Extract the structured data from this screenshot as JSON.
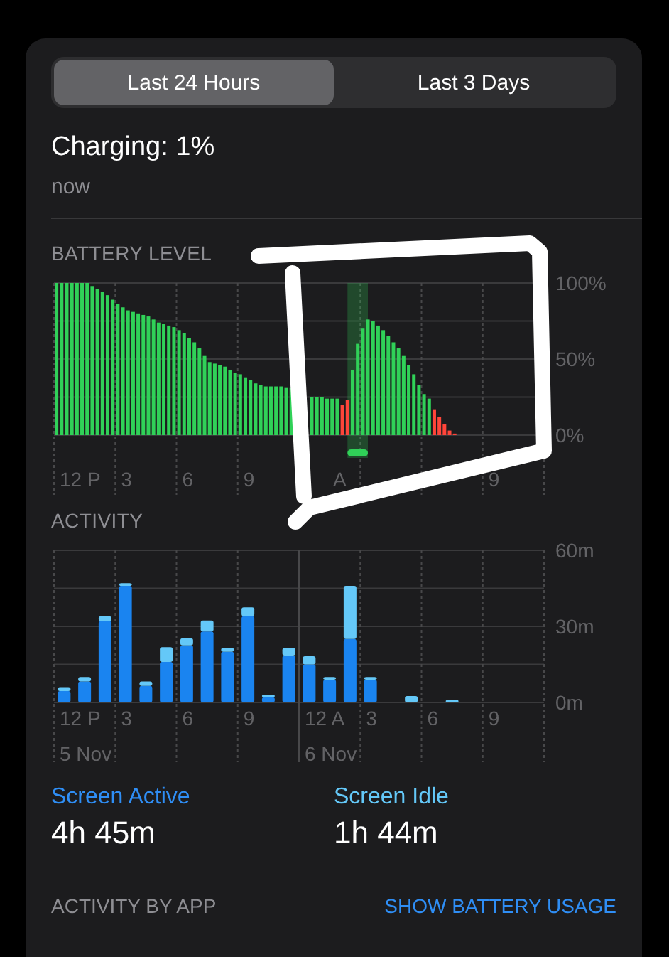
{
  "tabs": [
    {
      "label": "Last 24 Hours",
      "selected": true
    },
    {
      "label": "Last 3 Days",
      "selected": false
    }
  ],
  "status": {
    "title": "Charging: 1%",
    "time": "now"
  },
  "battery_level": {
    "label": "BATTERY LEVEL",
    "hour_labels": [
      "12 P",
      "3",
      "6",
      "9",
      "A",
      "9"
    ],
    "chart_data": {
      "type": "bar",
      "ylim": [
        0,
        100
      ],
      "series": [
        {
          "color": "#30d158",
          "values": [
            100,
            100,
            100,
            100,
            100,
            100,
            100,
            98,
            96,
            94,
            92,
            89,
            86,
            84,
            82,
            81,
            80,
            79,
            78,
            76,
            74,
            73,
            72,
            71,
            69,
            67,
            64,
            61,
            57,
            52,
            48,
            47,
            46,
            45,
            43,
            41,
            40,
            38,
            36,
            34,
            33,
            32,
            32,
            32,
            32,
            31,
            31,
            null,
            null,
            null,
            25,
            25,
            25,
            24,
            24,
            24,
            null,
            null,
            43,
            60,
            70,
            76,
            75,
            72,
            69,
            65,
            61,
            57,
            52,
            46,
            40,
            33,
            27,
            24,
            null,
            null,
            null,
            null,
            null,
            null,
            null,
            null,
            null,
            null,
            null,
            null,
            null,
            null,
            null,
            null,
            null,
            null,
            null,
            null,
            null,
            null
          ]
        },
        {
          "color": "#ff453a",
          "values": [
            null,
            null,
            null,
            null,
            null,
            null,
            null,
            null,
            null,
            null,
            null,
            null,
            null,
            null,
            null,
            null,
            null,
            null,
            null,
            null,
            null,
            null,
            null,
            null,
            null,
            null,
            null,
            null,
            null,
            null,
            null,
            null,
            null,
            null,
            null,
            null,
            null,
            null,
            null,
            null,
            null,
            null,
            null,
            null,
            null,
            null,
            null,
            null,
            null,
            null,
            null,
            null,
            null,
            null,
            null,
            null,
            20,
            23,
            null,
            null,
            null,
            null,
            null,
            null,
            null,
            null,
            null,
            null,
            null,
            null,
            null,
            null,
            null,
            null,
            17,
            12,
            7,
            3,
            1,
            null,
            null,
            null,
            null,
            null,
            null,
            null,
            null,
            null,
            null,
            null,
            null,
            null,
            null,
            null,
            null,
            null
          ]
        }
      ],
      "yticks": [
        {
          "value": 0,
          "label": "0%"
        },
        {
          "value": 50,
          "label": "50%"
        },
        {
          "value": 100,
          "label": "100%"
        }
      ]
    }
  },
  "activity": {
    "label": "ACTIVITY",
    "hour_labels": [
      "12 P",
      "3",
      "6",
      "9",
      "12 A",
      "3",
      "6",
      "9"
    ],
    "chart_data": {
      "type": "bar",
      "stacked": true,
      "ylim": [
        0,
        60
      ],
      "series": [
        {
          "color": "#1a84f0",
          "values": [
            4.5,
            8.3,
            32,
            46,
            6.5,
            16,
            22.5,
            28,
            20,
            34,
            2,
            18.5,
            15,
            9,
            25,
            9,
            null,
            null,
            null,
            null,
            null,
            null,
            null,
            null
          ]
        },
        {
          "color": "#64c8f8",
          "values": [
            1.5,
            1.7,
            2,
            1,
            1.8,
            5.8,
            2.8,
            4.3,
            1.5,
            3.5,
            1,
            3,
            3.2,
            1,
            21,
            1,
            null,
            2.5,
            null,
            1,
            null,
            null,
            null,
            null
          ]
        }
      ],
      "yticks": [
        {
          "value": 0,
          "label": "0m"
        },
        {
          "value": 30,
          "label": "30m"
        },
        {
          "value": 60,
          "label": "60m"
        }
      ]
    },
    "dates": [
      "5 Nov",
      "6 Nov"
    ]
  },
  "summary": [
    {
      "label": "Screen Active",
      "value": "4h 45m",
      "color": "#2f8ef5"
    },
    {
      "label": "Screen Idle",
      "value": "1h 44m",
      "color": "#64c8f8"
    }
  ],
  "footer": {
    "title": "ACTIVITY BY APP",
    "link": "SHOW BATTERY USAGE"
  }
}
